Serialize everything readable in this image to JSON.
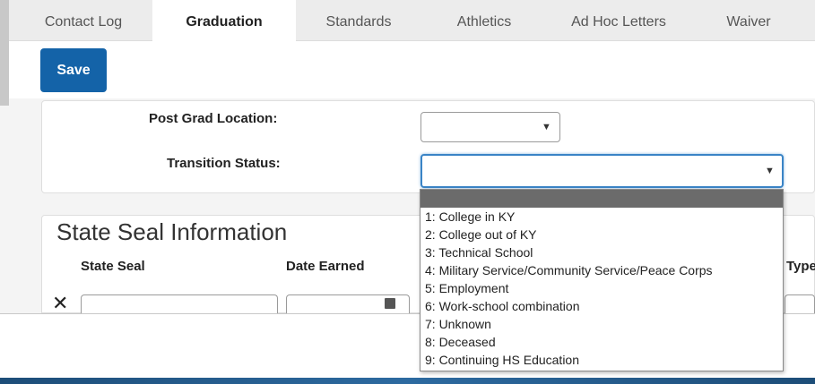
{
  "tabs": {
    "items": [
      "Contact Log",
      "Graduation",
      "Standards",
      "Athletics",
      "Ad Hoc Letters",
      "Waiver"
    ],
    "active": "Graduation"
  },
  "toolbar": {
    "save_label": "Save"
  },
  "form": {
    "post_grad_location_label": "Post Grad Location:",
    "transition_status_label": "Transition Status:"
  },
  "state_seal": {
    "title": "State Seal Information",
    "columns": {
      "state_seal": "State Seal",
      "date_earned": "Date Earned",
      "type": "Type"
    },
    "remove_glyph": "✕"
  },
  "dropdown": {
    "options": [
      "1: College in KY",
      "2: College out of KY",
      "3: Technical School",
      "4: Military Service/Community Service/Peace Corps",
      "5: Employment",
      "6: Work-school combination",
      "7: Unknown",
      "8: Deceased",
      "9: Continuing HS Education"
    ]
  },
  "colors": {
    "accent": "#1463a8",
    "focus": "#3a84c6",
    "highlight": "#6b6b6b"
  },
  "icons": {
    "caret": "caret-down-icon",
    "calendar": "calendar-icon",
    "remove": "close-icon"
  }
}
